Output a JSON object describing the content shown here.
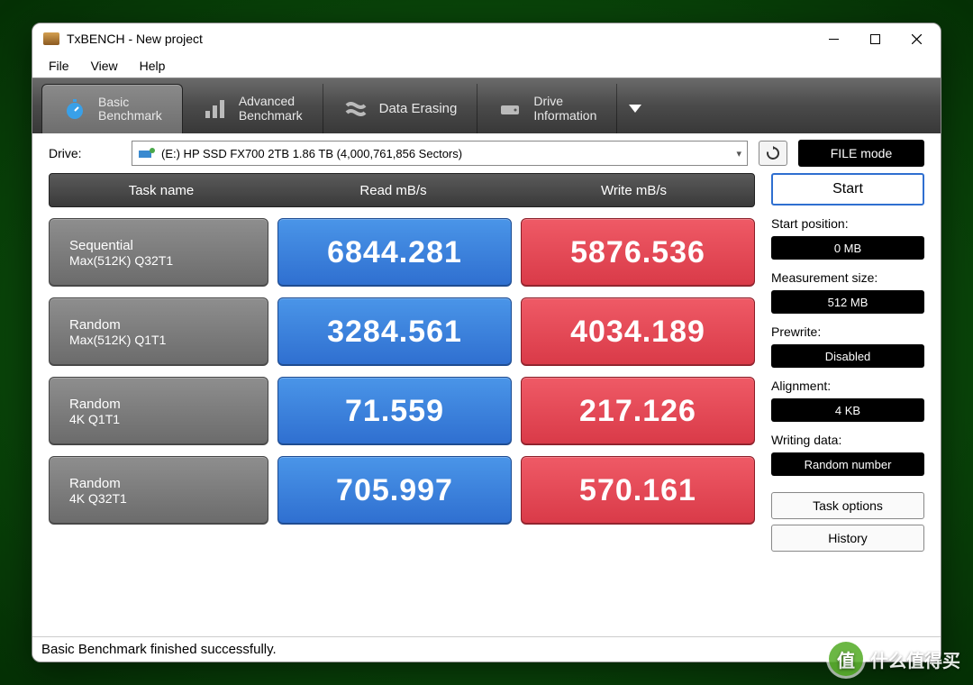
{
  "window": {
    "title": "TxBENCH - New project"
  },
  "menu": {
    "file": "File",
    "view": "View",
    "help": "Help"
  },
  "tabs": {
    "basic": {
      "l1": "Basic",
      "l2": "Benchmark"
    },
    "advanced": {
      "l1": "Advanced",
      "l2": "Benchmark"
    },
    "erase": {
      "l1": "Data Erasing",
      "l2": ""
    },
    "drive": {
      "l1": "Drive",
      "l2": "Information"
    }
  },
  "drive": {
    "label": "Drive:",
    "selected": "(E:) HP SSD FX700 2TB  1.86 TB (4,000,761,856 Sectors)",
    "mode_btn": "FILE mode"
  },
  "columns": {
    "task": "Task name",
    "read": "Read mB/s",
    "write": "Write mB/s"
  },
  "rows": [
    {
      "name1": "Sequential",
      "name2": "Max(512K) Q32T1",
      "read": "6844.281",
      "write": "5876.536"
    },
    {
      "name1": "Random",
      "name2": "Max(512K) Q1T1",
      "read": "3284.561",
      "write": "4034.189"
    },
    {
      "name1": "Random",
      "name2": "4K Q1T1",
      "read": "71.559",
      "write": "217.126"
    },
    {
      "name1": "Random",
      "name2": "4K Q32T1",
      "read": "705.997",
      "write": "570.161"
    }
  ],
  "side": {
    "start": "Start",
    "start_pos_label": "Start position:",
    "start_pos": "0 MB",
    "meas_label": "Measurement size:",
    "meas": "512 MB",
    "prewrite_label": "Prewrite:",
    "prewrite": "Disabled",
    "align_label": "Alignment:",
    "align": "4 KB",
    "writedata_label": "Writing data:",
    "writedata": "Random number",
    "task_options": "Task options",
    "history": "History"
  },
  "status": "Basic Benchmark finished successfully.",
  "watermark": "什么值得买",
  "chart_data": {
    "type": "table",
    "title": "TxBENCH Basic Benchmark — HP SSD FX700 2TB",
    "columns": [
      "Task",
      "Read mB/s",
      "Write mB/s"
    ],
    "rows": [
      [
        "Sequential Max(512K) Q32T1",
        6844.281,
        5876.536
      ],
      [
        "Random Max(512K) Q1T1",
        3284.561,
        4034.189
      ],
      [
        "Random 4K Q1T1",
        71.559,
        217.126
      ],
      [
        "Random 4K Q32T1",
        705.997,
        570.161
      ]
    ]
  }
}
